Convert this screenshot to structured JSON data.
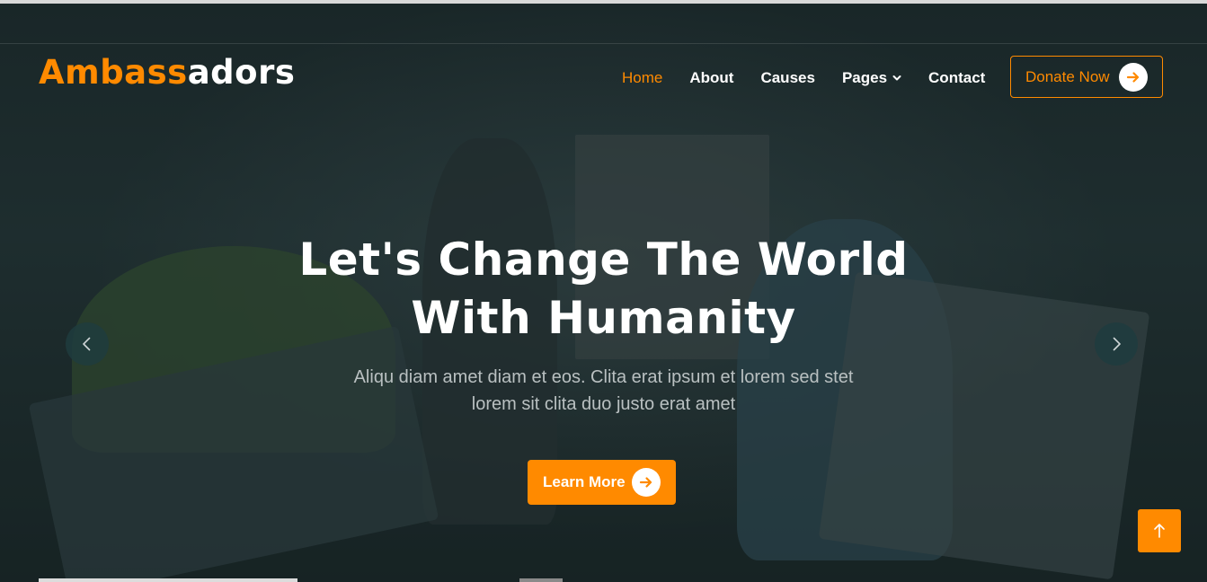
{
  "brand": {
    "part1": "Ambass",
    "part2": "adors"
  },
  "nav": {
    "items": [
      {
        "label": "Home",
        "active": true
      },
      {
        "label": "About"
      },
      {
        "label": "Causes"
      },
      {
        "label": "Pages",
        "has_dropdown": true
      },
      {
        "label": "Contact"
      }
    ],
    "donate_label": "Donate Now"
  },
  "hero": {
    "title_line1": "Let's Change The World",
    "title_line2": "With Humanity",
    "subtitle_line1": "Aliqu diam amet diam et eos. Clita erat ipsum et lorem sed stet",
    "subtitle_line2": "lorem sit clita duo justo erat amet",
    "cta_label": "Learn More"
  },
  "icons": {
    "arrow": "arrow-right-icon",
    "prev": "chevron-left-icon",
    "next": "chevron-right-icon",
    "dropdown": "chevron-down-icon",
    "back_to_top": "arrow-up-icon"
  },
  "colors": {
    "accent": "#ff8a00",
    "text": "#ffffff",
    "subtitle": "#b9c0c1",
    "nav_button_bg": "#1e3c3e"
  }
}
